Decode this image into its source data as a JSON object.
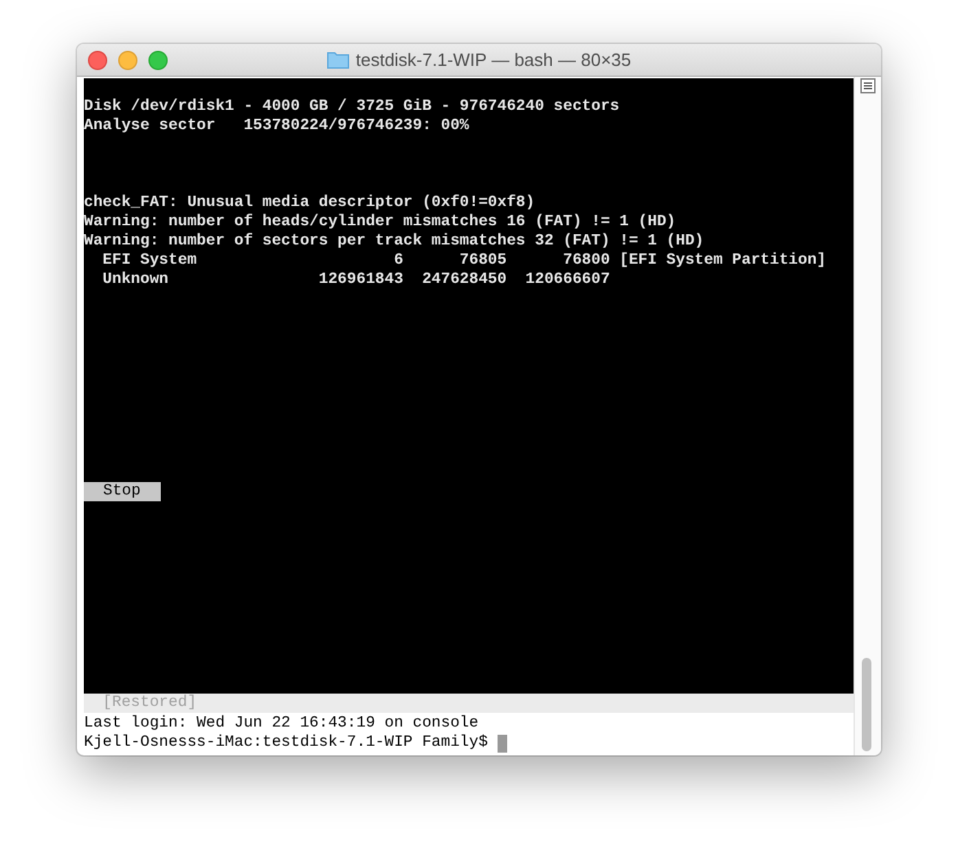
{
  "window": {
    "title": "testdisk-7.1-WIP — bash — 80×35"
  },
  "screen": {
    "header": [
      "Disk /dev/rdisk1 - 4000 GB / 3725 GiB - 976746240 sectors",
      "Analyse sector   153780224/976746239: 00%"
    ],
    "messages": [
      "check_FAT: Unusual media descriptor (0xf0!=0xf8)",
      "Warning: number of heads/cylinder mismatches 16 (FAT) != 1 (HD)",
      "Warning: number of sectors per track mismatches 32 (FAT) != 1 (HD)",
      "  EFI System                     6      76805      76800 [EFI System Partition]",
      "  Unknown                126961843  247628450  120666607"
    ],
    "button": {
      "label": "Stop"
    }
  },
  "restored": "  [Restored]",
  "shell": [
    "Last login: Wed Jun 22 16:43:19 on console",
    "Kjell-Osnesss-iMac:testdisk-7.1-WIP Family$"
  ]
}
